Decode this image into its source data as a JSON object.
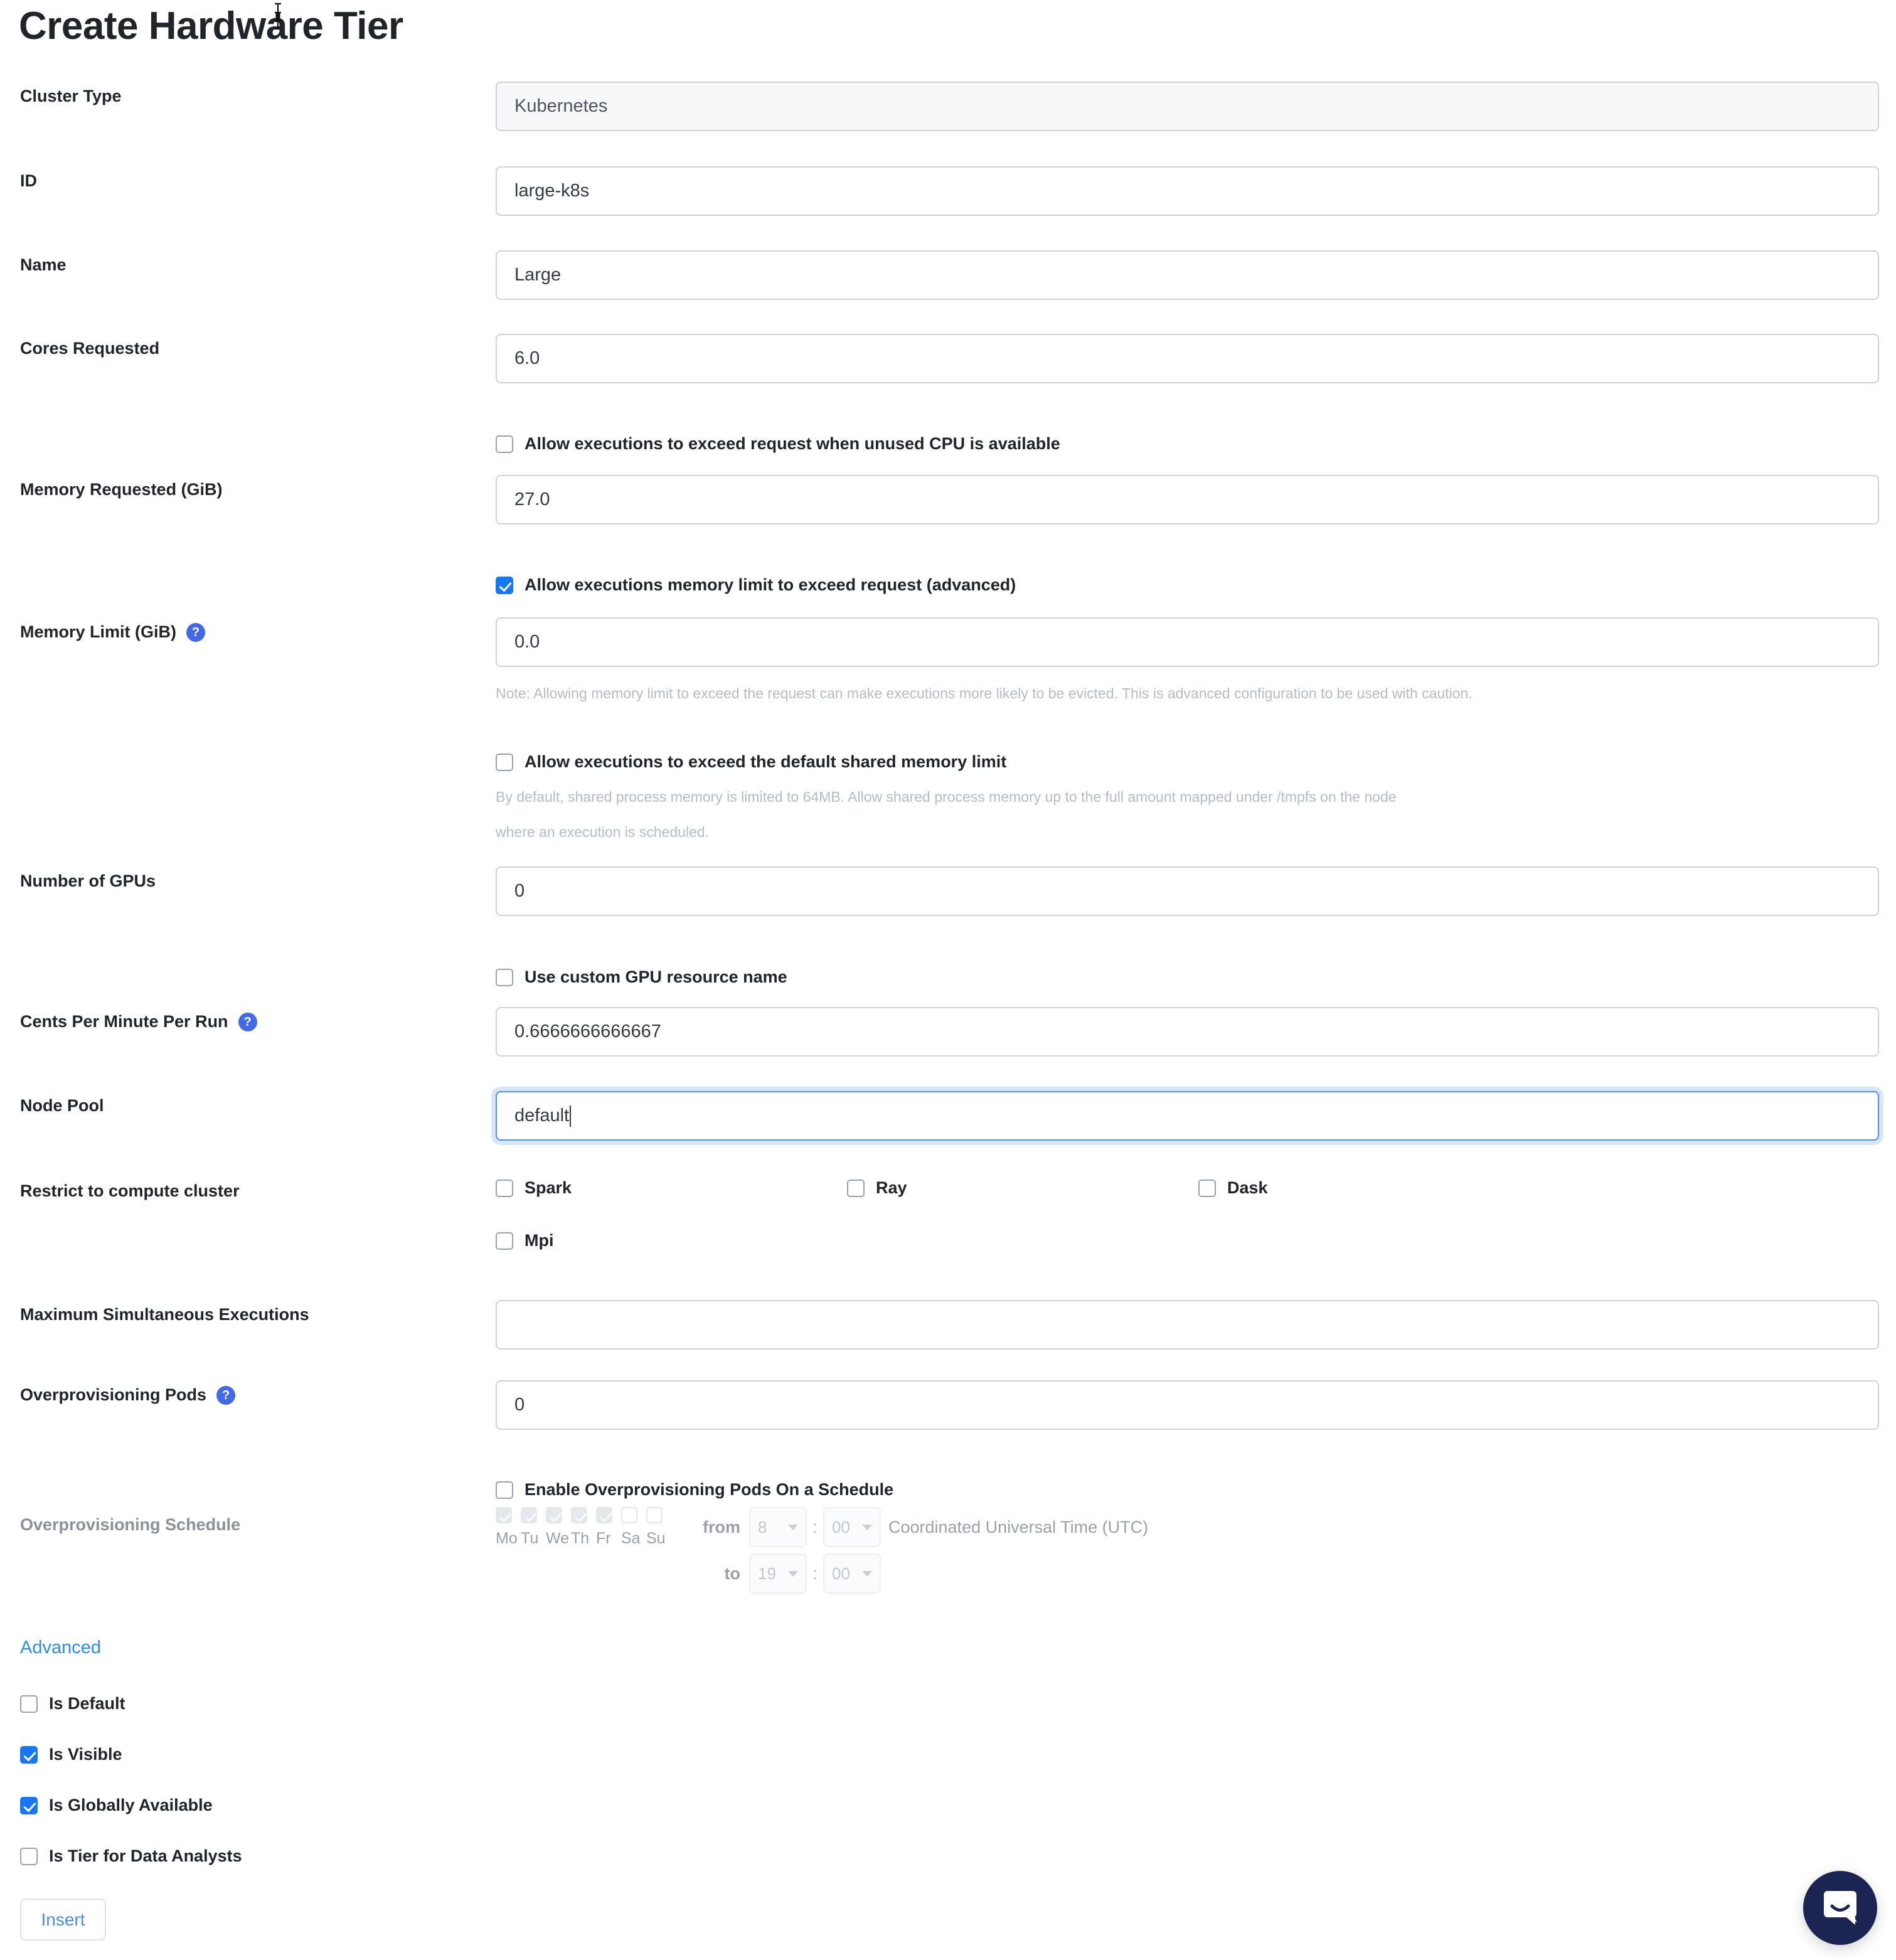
{
  "page": {
    "title": "Create Hardware Tier"
  },
  "fields": {
    "cluster_type": {
      "label": "Cluster Type",
      "value": "Kubernetes"
    },
    "id": {
      "label": "ID",
      "value": "large-k8s"
    },
    "name": {
      "label": "Name",
      "value": "Large"
    },
    "cores_requested": {
      "label": "Cores Requested",
      "value": "6.0"
    },
    "memory_requested": {
      "label": "Memory Requested (GiB)",
      "value": "27.0"
    },
    "memory_limit": {
      "label": "Memory Limit (GiB)",
      "value": "0.0",
      "help": "?"
    },
    "number_of_gpus": {
      "label": "Number of GPUs",
      "value": "0"
    },
    "cents_per_minute": {
      "label": "Cents Per Minute Per Run",
      "value": "0.6666666666667",
      "help": "?"
    },
    "node_pool": {
      "label": "Node Pool",
      "value": "default"
    },
    "restrict_cluster": {
      "label": "Restrict to compute cluster"
    },
    "max_simultaneous": {
      "label": "Maximum Simultaneous Executions",
      "value": ""
    },
    "overprovisioning_pods": {
      "label": "Overprovisioning Pods",
      "value": "0",
      "help": "?"
    },
    "overprovisioning_schedule": {
      "label": "Overprovisioning Schedule"
    }
  },
  "checkboxes": {
    "exceed_cpu": {
      "label": "Allow executions to exceed request when unused CPU is available",
      "checked": false
    },
    "memory_limit_exceed": {
      "label": "Allow executions memory limit to exceed request (advanced)",
      "checked": true
    },
    "shared_memory": {
      "label": "Allow executions to exceed the default shared memory limit",
      "checked": false
    },
    "custom_gpu": {
      "label": "Use custom GPU resource name",
      "checked": false
    },
    "enable_overprov_schedule": {
      "label": "Enable Overprovisioning Pods On a Schedule",
      "checked": false
    }
  },
  "notes": {
    "memory_limit_note": "Note: Allowing memory limit to exceed the request can make executions more likely to be evicted. This is advanced configuration to be used with caution.",
    "shared_memory_note_line1": "By default, shared process memory is limited to 64MB. Allow shared process memory up to the full amount mapped under /tmpfs on the node",
    "shared_memory_note_line2": "where an execution is scheduled."
  },
  "compute_clusters": [
    {
      "label": "Spark",
      "checked": false
    },
    {
      "label": "Ray",
      "checked": false
    },
    {
      "label": "Dask",
      "checked": false
    },
    {
      "label": "Mpi",
      "checked": false
    }
  ],
  "schedule": {
    "days": [
      {
        "short": "Mo",
        "checked": true
      },
      {
        "short": "Tu",
        "checked": true
      },
      {
        "short": "We",
        "checked": true
      },
      {
        "short": "Th",
        "checked": true
      },
      {
        "short": "Fr",
        "checked": true
      },
      {
        "short": "Sa",
        "checked": false
      },
      {
        "short": "Su",
        "checked": false
      }
    ],
    "from_label": "from",
    "to_label": "to",
    "from_hour": "8",
    "from_minute": "00",
    "to_hour": "19",
    "to_minute": "00",
    "colon": ":",
    "timezone": "Coordinated Universal Time (UTC)"
  },
  "advanced": {
    "link_label": "Advanced",
    "options": [
      {
        "label": "Is Default",
        "checked": false
      },
      {
        "label": "Is Visible",
        "checked": true
      },
      {
        "label": "Is Globally Available",
        "checked": true
      },
      {
        "label": "Is Tier for Data Analysts",
        "checked": false
      }
    ]
  },
  "actions": {
    "insert_label": "Insert"
  },
  "colors": {
    "accent_blue": "#1877f2",
    "link_blue": "#2a8cf5",
    "help_blue": "#4169e8",
    "chat_navy": "#1b2452"
  }
}
